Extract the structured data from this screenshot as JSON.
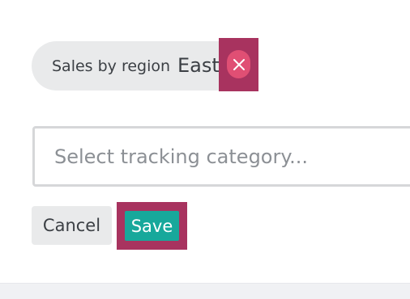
{
  "filter_chip": {
    "category_label": "Sales by region",
    "value_label": "East",
    "remove_icon": "close-icon"
  },
  "tracking_select": {
    "placeholder": "Select tracking category..."
  },
  "actions": {
    "cancel_label": "Cancel",
    "save_label": "Save"
  },
  "colors": {
    "highlight": "#a8335f",
    "remove_button": "#e04f74",
    "save_button": "#17a89b",
    "chip_background": "#e9eaeb"
  }
}
